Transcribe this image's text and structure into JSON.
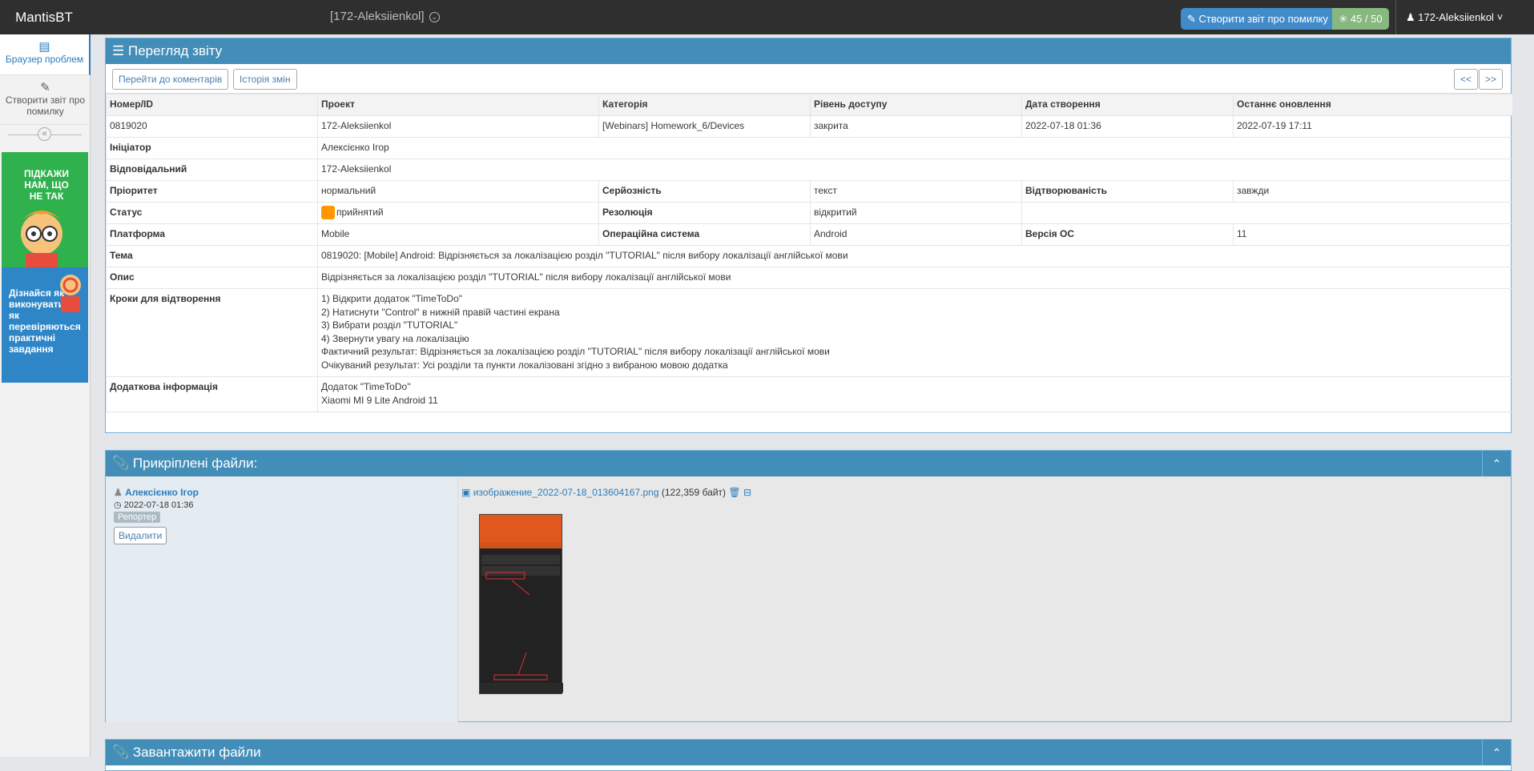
{
  "navbar": {
    "brand": "MantisBT",
    "project": "[172-Aleksiienkol]",
    "report_button": "Створити звіт про помилку",
    "count": "45 / 50",
    "user": "172-Aleksiienkol"
  },
  "sidebar": {
    "items": [
      {
        "label": "Браузер проблем",
        "icon": "list-icon"
      },
      {
        "label": "Створити звіт про помилку",
        "icon": "edit-icon"
      }
    ],
    "ad1": "ПІДКАЖИ НАМ, ЩО НЕ ТАК",
    "ad2": "Дізнайся як виконувати і як перевіряються практичні завдання"
  },
  "view": {
    "title": "Перегляд звіту",
    "btn_comments": "Перейти до коментарів",
    "btn_history": "Історія змін",
    "prev": "<<",
    "next": ">>",
    "headers": [
      "Номер/ID",
      "Проект",
      "Категорія",
      "Рівень доступу",
      "Дата створення",
      "Останнє оновлення"
    ],
    "row": [
      "0819020",
      "172-Aleksiienkol",
      "[Webinars] Homework_6/Devices",
      "закрита",
      "2022-07-18 01:36",
      "2022-07-19 17:11"
    ],
    "reporter_label": "Ініціатор",
    "reporter": "Алексієнко Ігор",
    "assigned_label": "Відповідальний",
    "assigned": "172-Aleksiienkol",
    "priority_label": "Пріоритет",
    "priority": "нормальний",
    "severity_label": "Серйозність",
    "severity": "текст",
    "repro_label": "Відтворюваність",
    "repro": "завжди",
    "status_label": "Статус",
    "status": "прийнятий",
    "resolution_label": "Резолюція",
    "resolution": "відкритий",
    "platform_label": "Платформа",
    "platform": "Mobile",
    "os_label": "Операційна система",
    "os": "Android",
    "osver_label": "Версія ОС",
    "osver": "11",
    "summary_label": "Тема",
    "summary": "0819020: [Mobile] Android: Відрізняється за локалізацією розділ \"TUTORIAL\" після вибору локалізації англійської мови",
    "desc_label": "Опис",
    "desc": "Відрізняється за локалізацією розділ \"TUTORIAL\" після вибору локалізації англійської мови",
    "steps_label": "Кроки для відтворення",
    "steps": [
      "1) Відкрити додаток \"TimeToDo\"",
      "2) Натиснути \"Control\" в нижній правій частині екрана",
      "3) Вибрати розділ \"TUTORIAL\"",
      "4) Звернути увагу на локалізацію",
      "Фактичний результат: Відрізняється за локалізацією розділ \"TUTORIAL\" після вибору локалізації англійської мови",
      "Очікуваний результат: Усі розділи та пункти локалізовані згідно з вибраною мовою додатка"
    ],
    "info_label": "Додаткова інформація",
    "info": [
      "Додаток \"TimeToDo\"",
      "Xiaomi MI 9 Lite Android 11"
    ]
  },
  "attachments": {
    "title": "Прикріплені файли:",
    "author": "Алексієнко Ігор",
    "date": "2022-07-18 01:36",
    "badge": "Репортер",
    "delete": "Видалити",
    "file": "изображение_2022-07-18_013604167.png",
    "size": "(122,359 байт)"
  },
  "upload": {
    "title": "Завантажити файли"
  }
}
